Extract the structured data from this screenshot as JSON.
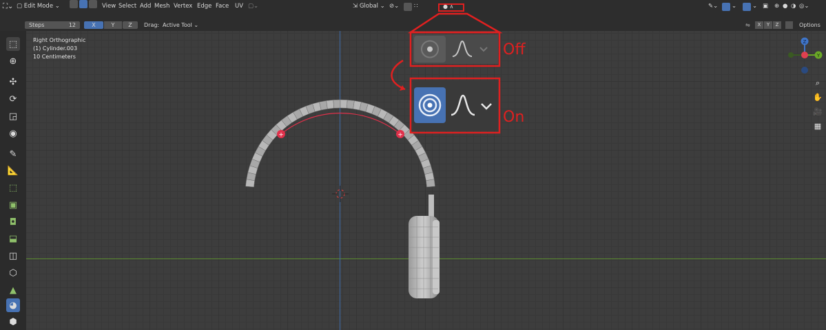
{
  "header": {
    "mode_label": "Edit Mode",
    "menu": [
      "View",
      "Select",
      "Add",
      "Mesh",
      "Vertex",
      "Edge",
      "Face",
      "UV"
    ],
    "transform_orientation": "Global",
    "options_label": "Options"
  },
  "tool_header": {
    "steps_label": "Steps",
    "steps_value": "12",
    "axes": [
      "X",
      "Y",
      "Z"
    ],
    "drag_label": "Drag:",
    "drag_value": "Active Tool"
  },
  "viewport": {
    "view_name": "Right Orthographic",
    "object_name": "(1) Cylinder.003",
    "scale": "10 Centimeters"
  },
  "callout": {
    "off_label": "Off",
    "on_label": "On"
  },
  "colors": {
    "accent_blue": "#4772b3",
    "annotation_red": "#e02020",
    "x_axis": "#e04050",
    "y_axis": "#6aa827",
    "z_axis": "#3f75c8"
  },
  "icons": [
    "proportional-editing-icon",
    "falloff-curve-icon",
    "chevron-down-icon"
  ]
}
